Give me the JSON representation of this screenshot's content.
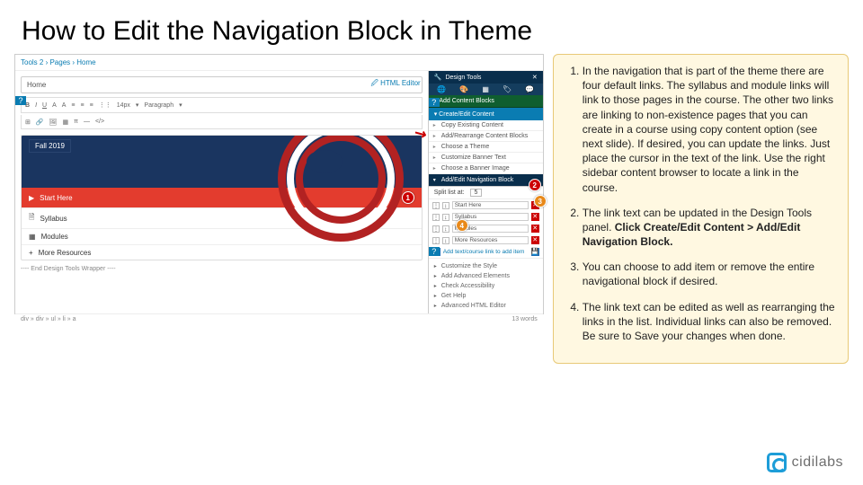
{
  "title": "How to Edit the Navigation Block in Theme",
  "screenshot": {
    "breadcrumb": {
      "a": "Tools 2",
      "b": "Pages",
      "c": "Home"
    },
    "homeField": "Home",
    "htmlEditorLink": "HTML Editor",
    "toolbar": {
      "fontSize": "14px",
      "paragraph": "Paragraph"
    },
    "fallLabel": "Fall 2019",
    "navItems": [
      {
        "icon": "▶",
        "label": "Start Here"
      },
      {
        "icon": "🗎",
        "label": "Syllabus"
      },
      {
        "icon": "▦",
        "label": "Modules"
      },
      {
        "icon": "+",
        "label": "More Resources"
      }
    ],
    "endWrapper": "---- End Design Tools Wrapper ----",
    "pathInfo": "div » div » ul » li » a",
    "wordCount": "13 words",
    "dt": {
      "title": "Design Tools",
      "addContent": "+ Add Content Blocks",
      "createEdit": "▾ Create/Edit Content",
      "sub1": "Copy Existing Content",
      "sub2": "Add/Rearrange Content Blocks",
      "sub3": "Choose a Theme",
      "sub4": "Customize Banner Text",
      "sub5": "Choose a Banner Image",
      "navBlock": "Add/Edit Navigation Block",
      "splitLabel": "Split list at:",
      "splitVal": "5",
      "links": [
        {
          "label": "Start Here"
        },
        {
          "label": "Syllabus"
        },
        {
          "label": "Modules"
        },
        {
          "label": "More Resources"
        }
      ],
      "addLinkNote": "Add text/course link to add item",
      "foot1": "Customize the Style",
      "foot2": "Add Advanced Elements",
      "foot3": "Check Accessibility",
      "foot4": "Get Help",
      "foot5": "Advanced HTML Editor"
    },
    "badges": {
      "b1": "1",
      "b2": "2",
      "b3": "3",
      "b4": "4"
    }
  },
  "instructions": {
    "item1": "In the navigation that is part of the theme there are four default links. The syllabus and module links will link to those pages in the course. The other two links are linking to non-existence pages that you can create in a course using copy content option (see next slide). If desired, you can update the links. Just place the cursor in the text of the link. Use the right sidebar content browser to locate a link in the course.",
    "item2a": "The link text can be updated in the Design Tools panel. ",
    "item2b": "Click Create/Edit Content > Add/Edit Navigation Block.",
    "item3": "You can choose to add item or remove the entire navigational block if desired.",
    "item4": "The link text can be edited as well as rearranging the links in the list. Individual links can also be removed. Be sure to Save your changes when done."
  },
  "logo": "cidilabs"
}
